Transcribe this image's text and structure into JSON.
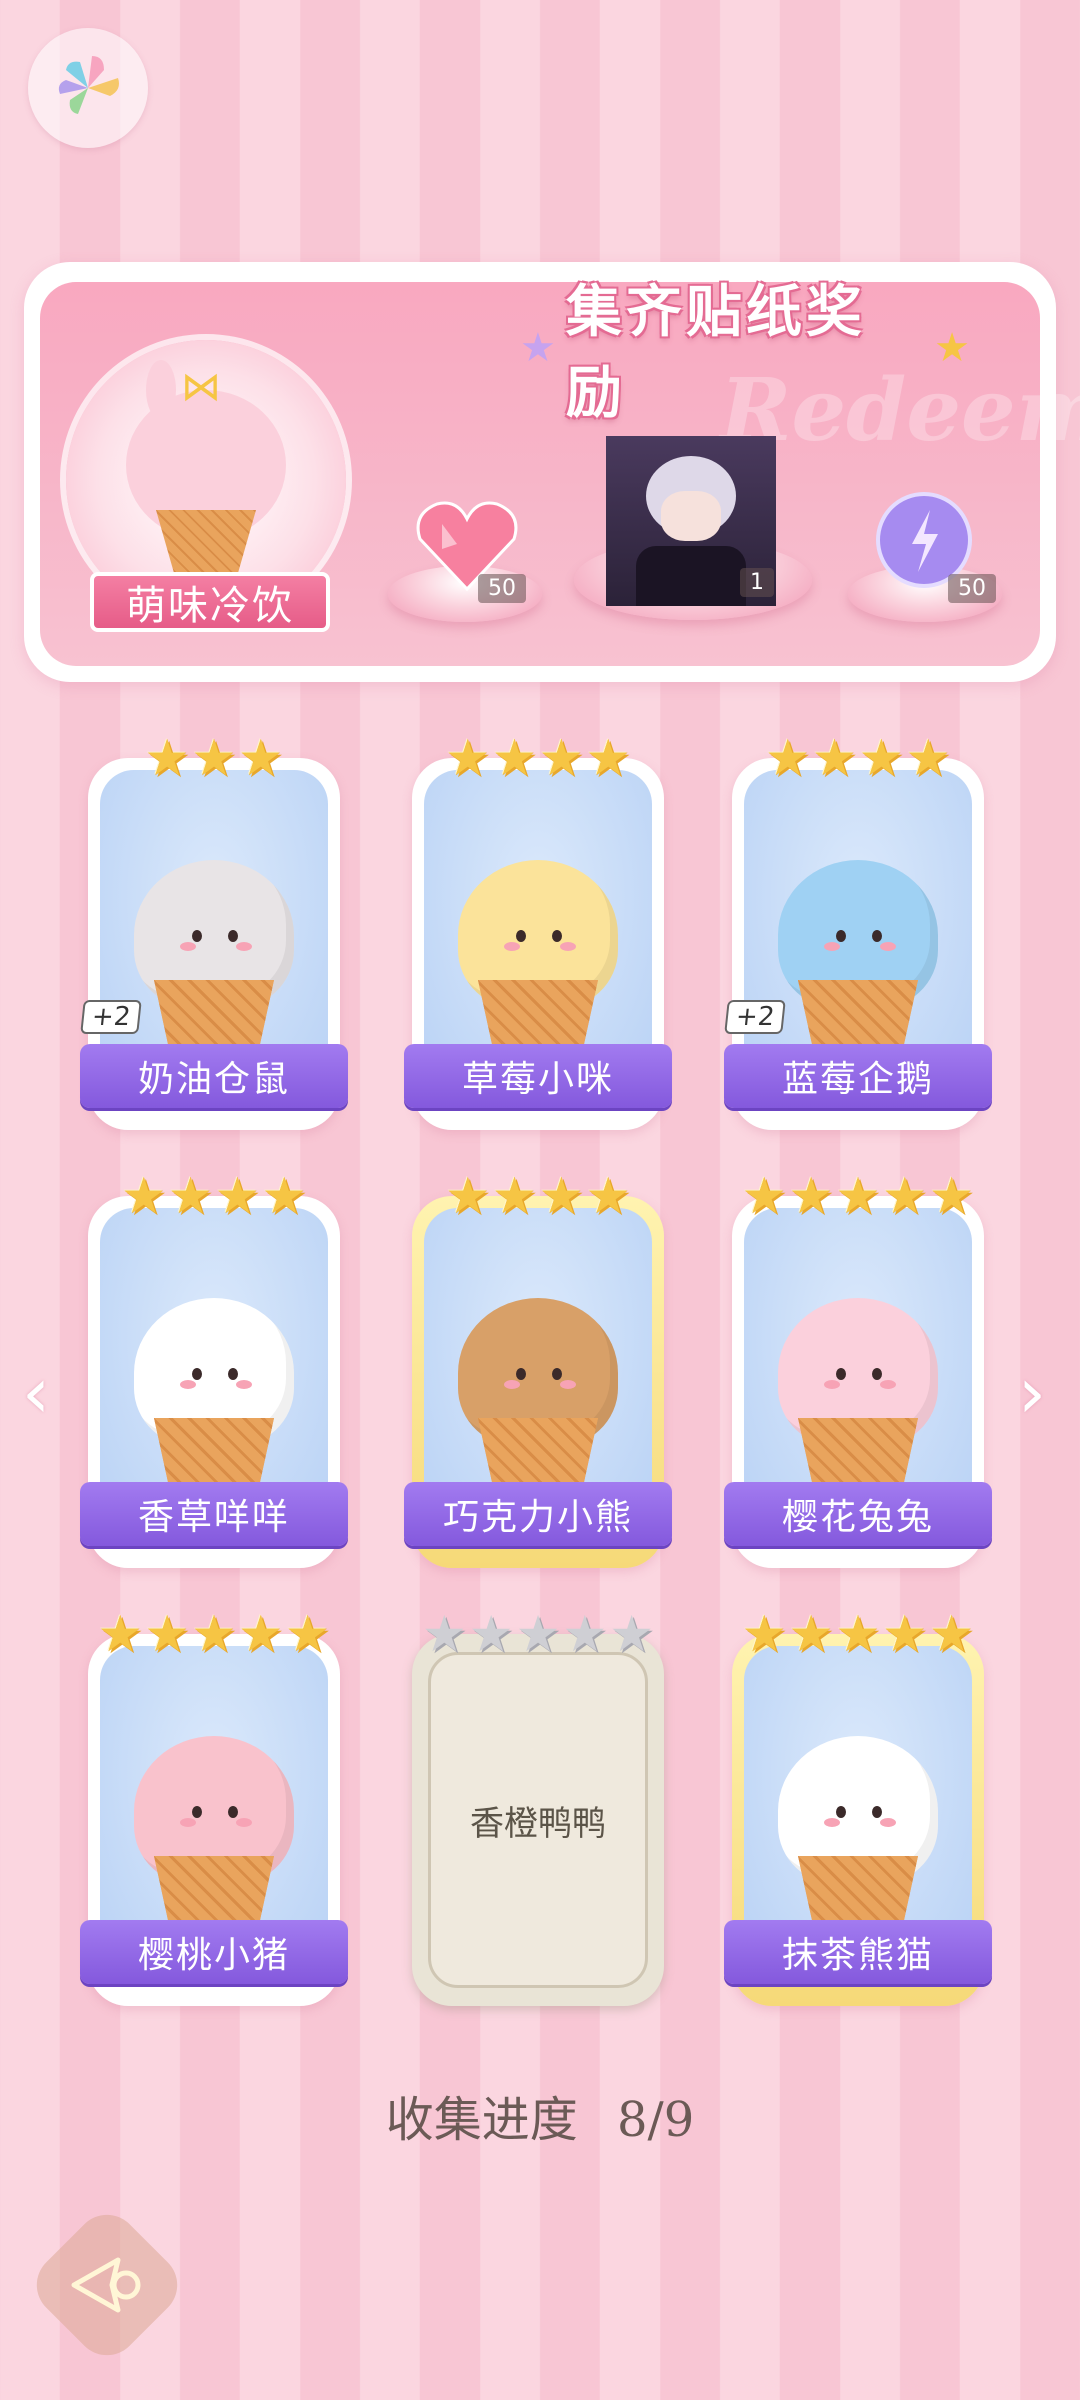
{
  "header": {
    "logo_icon": "pinwheel-logo-icon"
  },
  "reward": {
    "title": "集齐贴纸奖励",
    "watermark": "Redeem",
    "featured_name": "萌味冷饮",
    "items": [
      {
        "icon": "heart-gem-icon",
        "count": "50"
      },
      {
        "icon": "character-portrait",
        "count": "1"
      },
      {
        "icon": "energy-orb-icon",
        "count": "50"
      }
    ]
  },
  "stickers": [
    {
      "name": "奶油仓鼠",
      "stars": 3,
      "bonus": "+2",
      "color": "#e8e4e6",
      "collected": true
    },
    {
      "name": "草莓小咪",
      "stars": 4,
      "bonus": "",
      "color": "#fbe39a",
      "collected": true
    },
    {
      "name": "蓝莓企鹅",
      "stars": 4,
      "bonus": "+2",
      "color": "#9fd1f3",
      "collected": true
    },
    {
      "name": "香草咩咩",
      "stars": 4,
      "bonus": "",
      "color": "#ffffff",
      "collected": true
    },
    {
      "name": "巧克力小熊",
      "stars": 4,
      "bonus": "",
      "color": "#d8a068",
      "collected": true
    },
    {
      "name": "樱花兔兔",
      "stars": 5,
      "bonus": "",
      "color": "#fbd0dc",
      "collected": true
    },
    {
      "name": "樱桃小猪",
      "stars": 5,
      "bonus": "",
      "color": "#f9c2cc",
      "collected": true
    },
    {
      "name": "香橙鸭鸭",
      "stars": 5,
      "bonus": "",
      "color": "#efe9dd",
      "collected": false
    },
    {
      "name": "抹茶熊猫",
      "stars": 5,
      "bonus": "",
      "color": "#ffffff",
      "collected": true
    }
  ],
  "progress": {
    "label": "收集进度",
    "value": "8/9"
  },
  "nav": {
    "prev_icon": "chevron-left-icon",
    "next_icon": "chevron-right-icon",
    "back_icon": "back-arrow-icon"
  }
}
